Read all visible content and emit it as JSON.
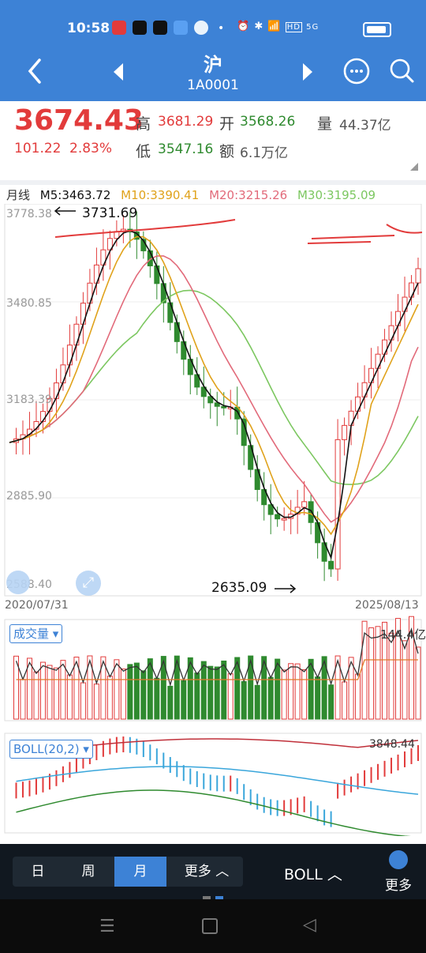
{
  "status_bar": {
    "time": "10:58",
    "right_icons": [
      "alarm-icon",
      "bluetooth-icon",
      "wifi-icon",
      "hd-icon",
      "signal-icon",
      "battery-icon"
    ],
    "hd": "HD",
    "net": "5G"
  },
  "header": {
    "title": "沪",
    "code": "1A0001"
  },
  "quote": {
    "price": "3674.43",
    "change": "101.22",
    "change_pct": "2.83%",
    "high_label": "高",
    "high": "3681.29",
    "open_label": "开",
    "open": "3568.26",
    "volume_label": "量",
    "volume": "44.37亿",
    "low_label": "低",
    "low": "3547.16",
    "amount_label": "额",
    "amount": "6.1万亿",
    "colors": {
      "up": "#e23b3b",
      "down": "#2f8a2f"
    }
  },
  "ma_legend": {
    "period": "月线",
    "m5": "M5:3463.72",
    "m10": "M10:3390.41",
    "m20": "M20:3215.26",
    "m30": "M30:3195.09"
  },
  "chart_data": [
    {
      "type": "candlestick",
      "title": "",
      "y_ticks": [
        "3778.38",
        "3480.85",
        "3183.39",
        "2885.90",
        "2588.40"
      ],
      "ylim": [
        2588.4,
        3778.38
      ],
      "max_annotation": "3731.69",
      "min_annotation": "2635.09",
      "x_start": "2020/07/31",
      "x_end": "2025/08/13",
      "series": [
        {
          "name": "M5",
          "color": "#111111"
        },
        {
          "name": "M10",
          "color": "#e0a21b"
        },
        {
          "name": "M20",
          "color": "#e26a7a"
        },
        {
          "name": "M30",
          "color": "#7cc760"
        }
      ]
    },
    {
      "type": "bar",
      "title": "成交量",
      "last_value": "144.4亿"
    },
    {
      "type": "line",
      "title": "BOLL(20,2)",
      "last_value": "3848.44"
    }
  ],
  "bottom_tabs": {
    "day": "日",
    "week": "周",
    "month": "月",
    "more": "更多",
    "boll": "BOLL",
    "more_btn": "更多"
  }
}
